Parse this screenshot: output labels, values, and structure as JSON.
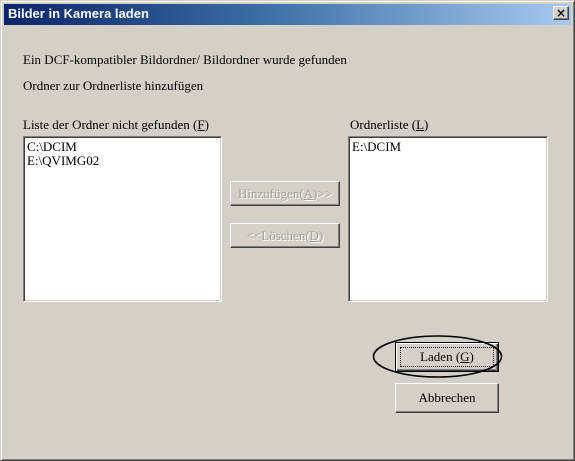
{
  "window": {
    "title": "Bilder in Kamera laden",
    "close_label": "×"
  },
  "messages": {
    "line1": "Ein DCF-kompatibler Bildordner/ Bildordner wurde gefunden",
    "line2": "Ordner zur Ordnerliste hinzufügen"
  },
  "left_list": {
    "label_prefix": "Liste der Ordner nicht gefunden (",
    "label_accel": "F",
    "label_suffix": ")",
    "items": [
      "C:\\DCIM",
      "E:\\QVIMG02"
    ]
  },
  "right_list": {
    "label_prefix": "Ordnerliste (",
    "label_accel": "L",
    "label_suffix": ")",
    "items": [
      "E:\\DCIM"
    ]
  },
  "buttons": {
    "add": {
      "prefix": "Hinzufügen(",
      "accel": "A",
      "suffix": ")>>",
      "enabled": false
    },
    "delete": {
      "prefix": "<<Löschen(",
      "accel": "D",
      "suffix": ")",
      "enabled": false
    },
    "load": {
      "prefix": "Laden (",
      "accel": "G",
      "suffix": ")",
      "default": true
    },
    "cancel": {
      "label": "Abbrechen"
    }
  },
  "colors": {
    "title_gradient_start": "#0a246a",
    "title_gradient_end": "#a6caf0",
    "dialog_face": "#d4d0c8"
  }
}
